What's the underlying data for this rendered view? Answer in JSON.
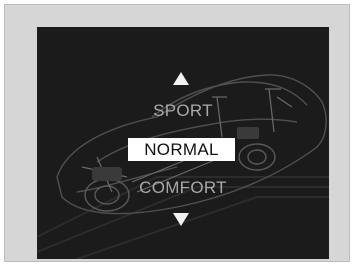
{
  "drive_mode_selector": {
    "modes_visible": [
      "SPORT",
      "NORMAL",
      "COMFORT"
    ],
    "selected_mode": "NORMAL",
    "labels": {
      "up_mode": "SPORT",
      "selected": "NORMAL",
      "down_mode": "COMFORT"
    },
    "icons": {
      "up": "up-triangle-arrow-icon",
      "down": "down-triangle-arrow-icon",
      "background": "car-chassis-illustration"
    },
    "colors": {
      "screen_background": "#1b1b1b",
      "selected_background": "#ffffff",
      "selected_text": "#111111",
      "unselected_text": "#a9a9a9",
      "arrow": "#f2f2f2"
    }
  }
}
